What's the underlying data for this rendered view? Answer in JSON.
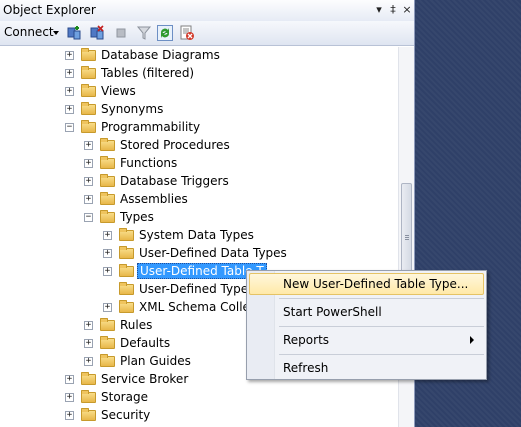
{
  "window": {
    "title": "Object Explorer",
    "pin_glyph": "▾",
    "dock_glyph": "‡",
    "close_glyph": "×"
  },
  "toolbar": {
    "connect_label": "Connect",
    "buttons": [
      "connect-object-icon",
      "disconnect-icon",
      "stop-icon",
      "filter-icon",
      "refresh-icon",
      "summary-icon"
    ]
  },
  "tree": {
    "items": [
      {
        "label": "Database Diagrams",
        "indent": 0,
        "expander": "+"
      },
      {
        "label": "Tables (filtered)",
        "indent": 0,
        "expander": "+"
      },
      {
        "label": "Views",
        "indent": 0,
        "expander": "+"
      },
      {
        "label": "Synonyms",
        "indent": 0,
        "expander": "+"
      },
      {
        "label": "Programmability",
        "indent": 0,
        "expander": "−"
      },
      {
        "label": "Stored Procedures",
        "indent": 1,
        "expander": "+"
      },
      {
        "label": "Functions",
        "indent": 1,
        "expander": "+"
      },
      {
        "label": "Database Triggers",
        "indent": 1,
        "expander": "+"
      },
      {
        "label": "Assemblies",
        "indent": 1,
        "expander": "+"
      },
      {
        "label": "Types",
        "indent": 1,
        "expander": "−"
      },
      {
        "label": "System Data Types",
        "indent": 2,
        "expander": "+"
      },
      {
        "label": "User-Defined Data Types",
        "indent": 2,
        "expander": "+"
      },
      {
        "label": "User-Defined Table T",
        "indent": 2,
        "expander": "+",
        "selected": true
      },
      {
        "label": "User-Defined Types",
        "indent": 2,
        "expander": ""
      },
      {
        "label": "XML Schema Collect",
        "indent": 2,
        "expander": "+"
      },
      {
        "label": "Rules",
        "indent": 1,
        "expander": "+"
      },
      {
        "label": "Defaults",
        "indent": 1,
        "expander": "+"
      },
      {
        "label": "Plan Guides",
        "indent": 1,
        "expander": "+"
      },
      {
        "label": "Service Broker",
        "indent": 0,
        "expander": "+"
      },
      {
        "label": "Storage",
        "indent": 0,
        "expander": "+"
      },
      {
        "label": "Security",
        "indent": 0,
        "expander": "+"
      }
    ]
  },
  "context_menu": {
    "items": [
      {
        "label": "New User-Defined Table Type...",
        "highlighted": true
      },
      {
        "label": "Start PowerShell"
      },
      {
        "label": "Reports",
        "submenu": true
      },
      {
        "label": "Refresh"
      }
    ]
  },
  "colors": {
    "selection": "#3399ff",
    "menu_highlight": "#ffe9a8",
    "desktop": "#2f4068"
  }
}
